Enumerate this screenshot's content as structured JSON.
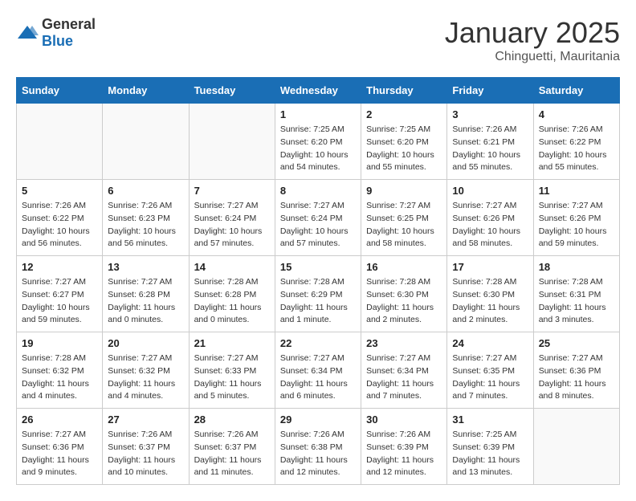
{
  "logo": {
    "general": "General",
    "blue": "Blue"
  },
  "title": "January 2025",
  "location": "Chinguetti, Mauritania",
  "weekdays": [
    "Sunday",
    "Monday",
    "Tuesday",
    "Wednesday",
    "Thursday",
    "Friday",
    "Saturday"
  ],
  "weeks": [
    [
      {
        "day": "",
        "info": ""
      },
      {
        "day": "",
        "info": ""
      },
      {
        "day": "",
        "info": ""
      },
      {
        "day": "1",
        "info": "Sunrise: 7:25 AM\nSunset: 6:20 PM\nDaylight: 10 hours\nand 54 minutes."
      },
      {
        "day": "2",
        "info": "Sunrise: 7:25 AM\nSunset: 6:20 PM\nDaylight: 10 hours\nand 55 minutes."
      },
      {
        "day": "3",
        "info": "Sunrise: 7:26 AM\nSunset: 6:21 PM\nDaylight: 10 hours\nand 55 minutes."
      },
      {
        "day": "4",
        "info": "Sunrise: 7:26 AM\nSunset: 6:22 PM\nDaylight: 10 hours\nand 55 minutes."
      }
    ],
    [
      {
        "day": "5",
        "info": "Sunrise: 7:26 AM\nSunset: 6:22 PM\nDaylight: 10 hours\nand 56 minutes."
      },
      {
        "day": "6",
        "info": "Sunrise: 7:26 AM\nSunset: 6:23 PM\nDaylight: 10 hours\nand 56 minutes."
      },
      {
        "day": "7",
        "info": "Sunrise: 7:27 AM\nSunset: 6:24 PM\nDaylight: 10 hours\nand 57 minutes."
      },
      {
        "day": "8",
        "info": "Sunrise: 7:27 AM\nSunset: 6:24 PM\nDaylight: 10 hours\nand 57 minutes."
      },
      {
        "day": "9",
        "info": "Sunrise: 7:27 AM\nSunset: 6:25 PM\nDaylight: 10 hours\nand 58 minutes."
      },
      {
        "day": "10",
        "info": "Sunrise: 7:27 AM\nSunset: 6:26 PM\nDaylight: 10 hours\nand 58 minutes."
      },
      {
        "day": "11",
        "info": "Sunrise: 7:27 AM\nSunset: 6:26 PM\nDaylight: 10 hours\nand 59 minutes."
      }
    ],
    [
      {
        "day": "12",
        "info": "Sunrise: 7:27 AM\nSunset: 6:27 PM\nDaylight: 10 hours\nand 59 minutes."
      },
      {
        "day": "13",
        "info": "Sunrise: 7:27 AM\nSunset: 6:28 PM\nDaylight: 11 hours\nand 0 minutes."
      },
      {
        "day": "14",
        "info": "Sunrise: 7:28 AM\nSunset: 6:28 PM\nDaylight: 11 hours\nand 0 minutes."
      },
      {
        "day": "15",
        "info": "Sunrise: 7:28 AM\nSunset: 6:29 PM\nDaylight: 11 hours\nand 1 minute."
      },
      {
        "day": "16",
        "info": "Sunrise: 7:28 AM\nSunset: 6:30 PM\nDaylight: 11 hours\nand 2 minutes."
      },
      {
        "day": "17",
        "info": "Sunrise: 7:28 AM\nSunset: 6:30 PM\nDaylight: 11 hours\nand 2 minutes."
      },
      {
        "day": "18",
        "info": "Sunrise: 7:28 AM\nSunset: 6:31 PM\nDaylight: 11 hours\nand 3 minutes."
      }
    ],
    [
      {
        "day": "19",
        "info": "Sunrise: 7:28 AM\nSunset: 6:32 PM\nDaylight: 11 hours\nand 4 minutes."
      },
      {
        "day": "20",
        "info": "Sunrise: 7:27 AM\nSunset: 6:32 PM\nDaylight: 11 hours\nand 4 minutes."
      },
      {
        "day": "21",
        "info": "Sunrise: 7:27 AM\nSunset: 6:33 PM\nDaylight: 11 hours\nand 5 minutes."
      },
      {
        "day": "22",
        "info": "Sunrise: 7:27 AM\nSunset: 6:34 PM\nDaylight: 11 hours\nand 6 minutes."
      },
      {
        "day": "23",
        "info": "Sunrise: 7:27 AM\nSunset: 6:34 PM\nDaylight: 11 hours\nand 7 minutes."
      },
      {
        "day": "24",
        "info": "Sunrise: 7:27 AM\nSunset: 6:35 PM\nDaylight: 11 hours\nand 7 minutes."
      },
      {
        "day": "25",
        "info": "Sunrise: 7:27 AM\nSunset: 6:36 PM\nDaylight: 11 hours\nand 8 minutes."
      }
    ],
    [
      {
        "day": "26",
        "info": "Sunrise: 7:27 AM\nSunset: 6:36 PM\nDaylight: 11 hours\nand 9 minutes."
      },
      {
        "day": "27",
        "info": "Sunrise: 7:26 AM\nSunset: 6:37 PM\nDaylight: 11 hours\nand 10 minutes."
      },
      {
        "day": "28",
        "info": "Sunrise: 7:26 AM\nSunset: 6:37 PM\nDaylight: 11 hours\nand 11 minutes."
      },
      {
        "day": "29",
        "info": "Sunrise: 7:26 AM\nSunset: 6:38 PM\nDaylight: 11 hours\nand 12 minutes."
      },
      {
        "day": "30",
        "info": "Sunrise: 7:26 AM\nSunset: 6:39 PM\nDaylight: 11 hours\nand 12 minutes."
      },
      {
        "day": "31",
        "info": "Sunrise: 7:25 AM\nSunset: 6:39 PM\nDaylight: 11 hours\nand 13 minutes."
      },
      {
        "day": "",
        "info": ""
      }
    ]
  ]
}
